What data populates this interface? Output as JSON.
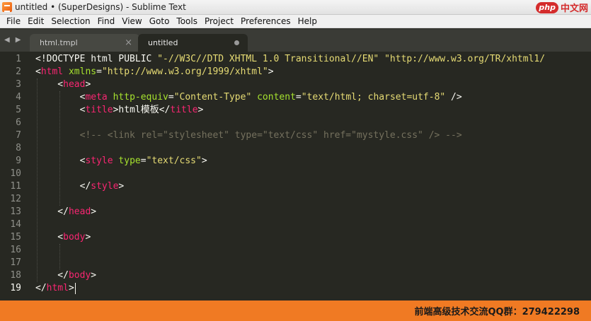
{
  "window": {
    "title": "untitled • (SuperDesigns) - Sublime Text",
    "watermark_badge": "php",
    "watermark_text": "中文网"
  },
  "menu": [
    "File",
    "Edit",
    "Selection",
    "Find",
    "View",
    "Goto",
    "Tools",
    "Project",
    "Preferences",
    "Help"
  ],
  "tabs": [
    {
      "label": "html.tmpl",
      "active": false,
      "close_glyph": "×"
    },
    {
      "label": "untitled",
      "active": true,
      "dirty": true
    }
  ],
  "tab_nav": "◀▶",
  "editor": {
    "active_line": 19,
    "line_numbers": [
      "1",
      "2",
      "3",
      "4",
      "5",
      "6",
      "7",
      "8",
      "9",
      "10",
      "11",
      "12",
      "13",
      "14",
      "15",
      "16",
      "17",
      "18",
      "19"
    ],
    "lines": [
      [
        {
          "t": "<!DOCTYPE html PUBLIC ",
          "c": "plain"
        },
        {
          "t": "\"-//W3C//DTD XHTML 1.0 Transitional//EN\"",
          "c": "str"
        },
        {
          "t": " ",
          "c": "plain"
        },
        {
          "t": "\"http://www.w3.org/TR/xhtml1/",
          "c": "str"
        }
      ],
      [
        {
          "t": "<",
          "c": "plain"
        },
        {
          "t": "html",
          "c": "tag"
        },
        {
          "t": " ",
          "c": "plain"
        },
        {
          "t": "xmlns",
          "c": "attr"
        },
        {
          "t": "=",
          "c": "plain"
        },
        {
          "t": "\"http://www.w3.org/1999/xhtml\"",
          "c": "str"
        },
        {
          "t": ">",
          "c": "plain"
        }
      ],
      [
        {
          "t": "    <",
          "c": "plain"
        },
        {
          "t": "head",
          "c": "tag"
        },
        {
          "t": ">",
          "c": "plain"
        }
      ],
      [
        {
          "t": "        <",
          "c": "plain"
        },
        {
          "t": "meta",
          "c": "tag"
        },
        {
          "t": " ",
          "c": "plain"
        },
        {
          "t": "http-equiv",
          "c": "attr"
        },
        {
          "t": "=",
          "c": "plain"
        },
        {
          "t": "\"Content-Type\"",
          "c": "str"
        },
        {
          "t": " ",
          "c": "plain"
        },
        {
          "t": "content",
          "c": "attr"
        },
        {
          "t": "=",
          "c": "plain"
        },
        {
          "t": "\"text/html; charset=utf-8\"",
          "c": "str"
        },
        {
          "t": " />",
          "c": "plain"
        }
      ],
      [
        {
          "t": "        <",
          "c": "plain"
        },
        {
          "t": "title",
          "c": "tag"
        },
        {
          "t": ">html模板</",
          "c": "plain"
        },
        {
          "t": "title",
          "c": "tag"
        },
        {
          "t": ">",
          "c": "plain"
        }
      ],
      [],
      [
        {
          "t": "        <!-- <link rel=\"stylesheet\" type=\"text/css\" href=\"mystyle.css\" /> -->",
          "c": "com"
        }
      ],
      [],
      [
        {
          "t": "        <",
          "c": "plain"
        },
        {
          "t": "style",
          "c": "tag"
        },
        {
          "t": " ",
          "c": "plain"
        },
        {
          "t": "type",
          "c": "attr"
        },
        {
          "t": "=",
          "c": "plain"
        },
        {
          "t": "\"text/css\"",
          "c": "str"
        },
        {
          "t": ">",
          "c": "plain"
        }
      ],
      [],
      [
        {
          "t": "        </",
          "c": "plain"
        },
        {
          "t": "style",
          "c": "tag"
        },
        {
          "t": ">",
          "c": "plain"
        }
      ],
      [],
      [
        {
          "t": "    </",
          "c": "plain"
        },
        {
          "t": "head",
          "c": "tag"
        },
        {
          "t": ">",
          "c": "plain"
        }
      ],
      [],
      [
        {
          "t": "    <",
          "c": "plain"
        },
        {
          "t": "body",
          "c": "tag"
        },
        {
          "t": ">",
          "c": "plain"
        }
      ],
      [],
      [],
      [
        {
          "t": "    </",
          "c": "plain"
        },
        {
          "t": "body",
          "c": "tag"
        },
        {
          "t": ">",
          "c": "plain"
        }
      ],
      [
        {
          "t": "</",
          "c": "plain"
        },
        {
          "t": "html",
          "c": "tag"
        },
        {
          "t": ">",
          "c": "plain"
        }
      ]
    ]
  },
  "footer": {
    "text": "前端高级技术交流QQ群：279422298"
  },
  "colors": {
    "editor_bg": "#272822",
    "tag": "#f92672",
    "attr": "#a6e22e",
    "string": "#e6db74",
    "comment": "#75715e",
    "footer_bg": "#f07a23"
  }
}
